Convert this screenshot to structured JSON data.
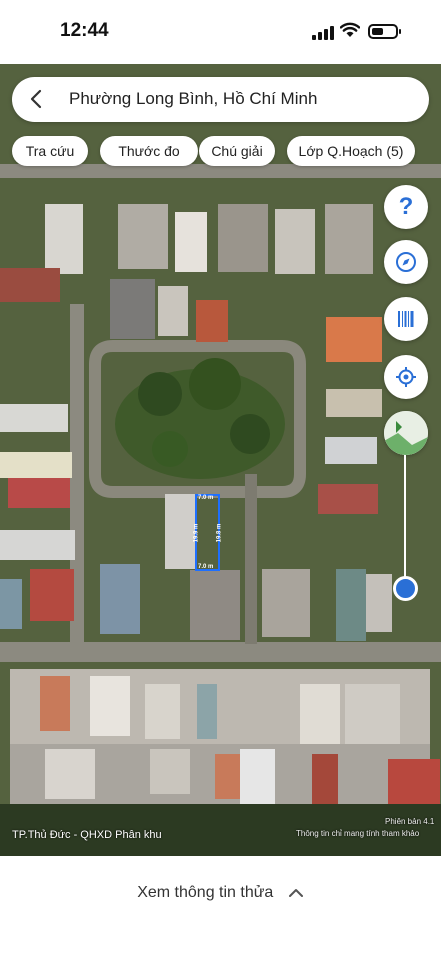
{
  "status_bar": {
    "time": "12:44"
  },
  "search": {
    "text": "Phường Long Bình, Hồ Chí Minh"
  },
  "chips": [
    {
      "label": "Tra cứu"
    },
    {
      "label": "Thước đo"
    },
    {
      "label": "Chú giải"
    },
    {
      "label": "Lớp Q.Hoạch (5)"
    }
  ],
  "controls": {
    "help_label": "?"
  },
  "map": {
    "plot_width": "7.0 m",
    "plot_length": "19.9 m",
    "plot_bottom": "7.0 m",
    "plot_length_2": "19.8 m",
    "planning_area": "TP.Thủ Đức - QHXD Phân khu",
    "version": "Phiên bản 4.1",
    "disclaimer": "Thông tin chỉ mang tính tham khảo"
  },
  "bottom": {
    "info_label": "Xem thông tin thửa"
  },
  "colors": {
    "accent": "#2a6fd6",
    "plot_outline": "#1e6fff"
  }
}
